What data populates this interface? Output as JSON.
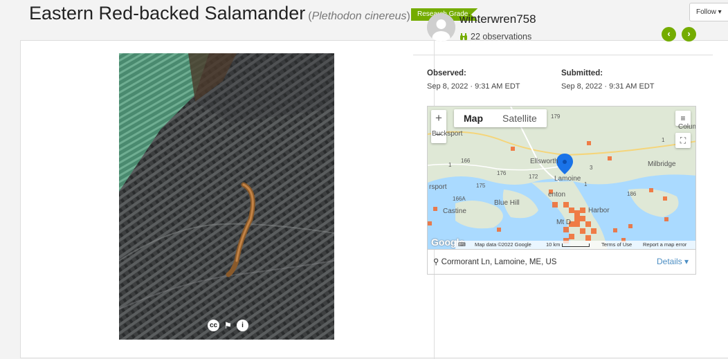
{
  "title": {
    "common_name": "Eastern Red-backed Salamander",
    "scientific_name": "Plethodon cinereus",
    "quality_badge": "Research Grade",
    "follow_label": "Follow"
  },
  "colors": {
    "accent_green": "#74ac00",
    "link_blue": "#4c8ec3",
    "map_cell_orange": "#f26a2e"
  },
  "photo": {
    "license_icon": "cc-icon",
    "flag_icon": "flag-icon",
    "info_icon": "info-icon"
  },
  "observer": {
    "username": "winterwren758",
    "observations": "22 observations",
    "obs_icon": "binoculars-icon"
  },
  "meta": {
    "observed_label": "Observed:",
    "observed_value": "Sep 8, 2022 · 9:31 AM EDT",
    "submitted_label": "Submitted:",
    "submitted_value": "Sep 8, 2022 · 9:31 AM EDT"
  },
  "map": {
    "tab_map": "Map",
    "tab_satellite": "Satellite",
    "zoom_in": "+",
    "zoom_out": "−",
    "labels": [
      "Bucksport",
      "Ellsworth",
      "Lamoine",
      "Milbridge",
      "Blue Hill",
      "Castine",
      "Harbor",
      "Mt D",
      "Columb",
      "rsport",
      "enton"
    ],
    "road_numbers": [
      "179",
      "166",
      "176",
      "172",
      "1",
      "3",
      "1",
      "186",
      "166A",
      "175",
      "1"
    ],
    "google": "Google",
    "attribution": "Map data ©2022 Google",
    "scale": "10 km",
    "terms": "Terms of Use",
    "report": "Report a map error"
  },
  "location": {
    "text": "Cormorant Ln, Lamoine, ME, US",
    "details": "Details"
  }
}
